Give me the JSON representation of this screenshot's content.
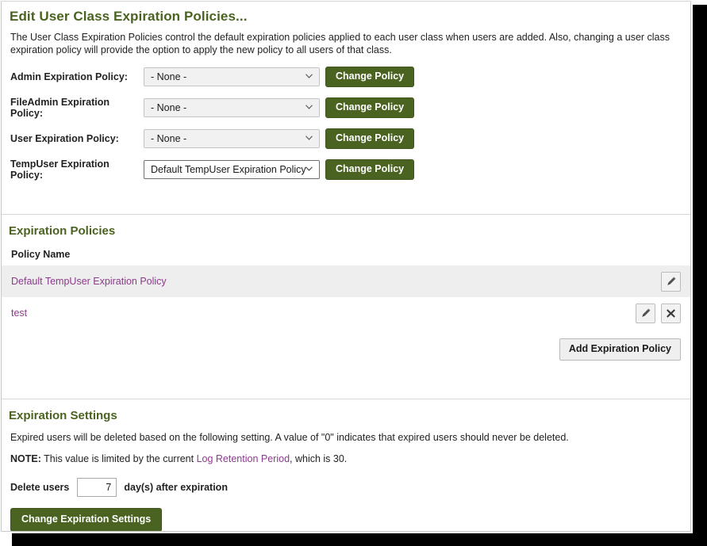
{
  "window": {
    "title": "Edit User Class Expiration Policies..."
  },
  "intro": {
    "text": "The User Class Expiration Policies control the default expiration policies applied to each user class when users are added. Also, changing a user class expiration policy will provide the option to apply the new policy to all users of that class."
  },
  "policy_form": {
    "rows": [
      {
        "label": "Admin Expiration Policy:",
        "value": "- None -",
        "button": "Change Policy",
        "emphasized": false
      },
      {
        "label": "FileAdmin Expiration Policy:",
        "value": "- None -",
        "button": "Change Policy",
        "emphasized": false
      },
      {
        "label": "User Expiration Policy:",
        "value": "- None -",
        "button": "Change Policy",
        "emphasized": false
      },
      {
        "label": "TempUser Expiration Policy:",
        "value": "Default TempUser Expiration Policy",
        "button": "Change Policy",
        "emphasized": true
      }
    ]
  },
  "policies_section": {
    "heading": "Expiration Policies",
    "column_header": "Policy Name",
    "rows": [
      {
        "name": "Default TempUser Expiration Policy",
        "has_edit": true,
        "has_delete": false
      },
      {
        "name": "test",
        "has_edit": true,
        "has_delete": true
      }
    ],
    "add_button": "Add Expiration Policy"
  },
  "settings_section": {
    "heading": "Expiration Settings",
    "description": "Expired users will be deleted based on the following setting. A value of \"0\" indicates that expired users should never be deleted.",
    "note_label": "NOTE:",
    "note_pre": " This value is limited by the current ",
    "note_link": "Log Retention Period",
    "note_post": ", which is 30.",
    "delete_label_pre": "Delete users",
    "delete_value": "7",
    "delete_label_post": "day(s) after expiration",
    "submit_button": "Change Expiration Settings"
  },
  "icons": {
    "chevron_down": "chevron-down-icon",
    "pencil": "pencil-icon",
    "close_x": "close-x-icon"
  },
  "colors": {
    "accent_green": "#4a6320",
    "link_purple": "#8c3a8c",
    "row_highlight": "#eeeeee"
  }
}
